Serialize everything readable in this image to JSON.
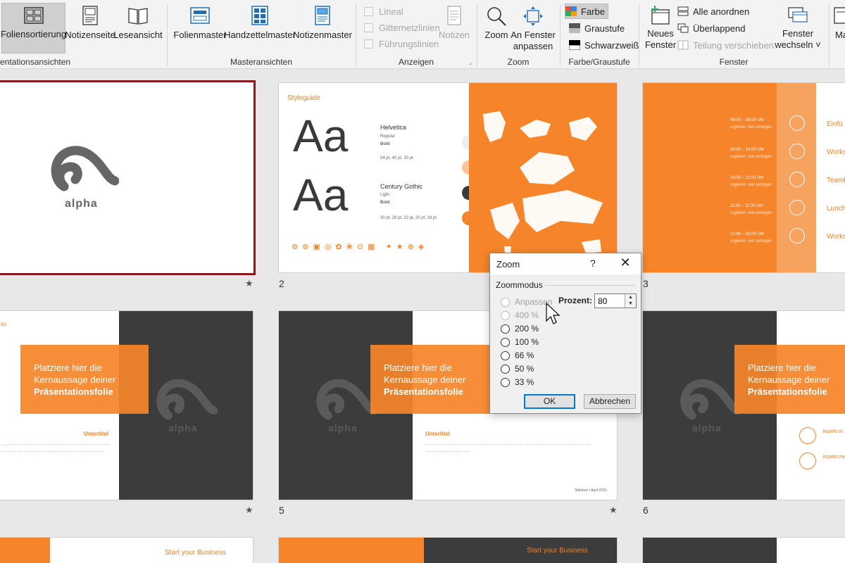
{
  "ribbon": {
    "groups": {
      "presentation_views": "entationsansichten",
      "master_views": "Masteransichten",
      "show": "Anzeigen",
      "zoom": "Zoom",
      "color": "Farbe/Graustufe",
      "window": "Fenster"
    },
    "buttons": {
      "slide_sorter": "Foliensortierung",
      "notes_page": "Notizenseite",
      "reading_view": "Leseansicht",
      "slide_master": "Folienmaster",
      "handout_master": "Handzettelmaster",
      "notes_master": "Notizenmaster",
      "ruler": "Lineal",
      "gridlines": "Gitternetzlinien",
      "guides": "Führungslinien",
      "notes": "Notizen",
      "zoom": "Zoom",
      "fit_window_1": "An Fenster",
      "fit_window_2": "anpassen",
      "color": "Farbe",
      "grayscale": "Graustufe",
      "black_white": "Schwarzweiß",
      "new_window_1": "Neues",
      "new_window_2": "Fenster",
      "arrange_all": "Alle anordnen",
      "cascade": "Überlappend",
      "move_split": "Teilung verschieben",
      "switch_window_1": "Fenster",
      "switch_window_2": "wechseln ˅",
      "macros": "Ma"
    }
  },
  "slides": {
    "s1": {
      "logo_word": "alpha"
    },
    "s2": {
      "num": "2",
      "title": "Styleguide",
      "aa": "Aa",
      "font1": "Helvetica",
      "font1_w1": "Regular",
      "font1_w2": "Bold",
      "font1_sizes": "54 pt, 40 pt, 30 pt",
      "font2": "Century Gothic",
      "font2_w1": "Light",
      "font2_w2": "Bold",
      "font2_sizes": "30 pt, 28 pt, 22 pt, 20 pt, 18 pt"
    },
    "s3": {
      "num": "3",
      "times": [
        "08:00 – 09:00 Uhr",
        "09:00 – 10:00 Uhr",
        "10:00 – 11:00 Uhr",
        "11:00 – 11:30 Uhr",
        "12:30 – 03:00 Uhr"
      ],
      "labels": [
        "Einfü",
        "Works",
        "Teaml",
        "Lunch",
        "Works"
      ],
      "caption": "Eigenen Text einfügen"
    },
    "callout": {
      "line1": "Platziere hier die",
      "line2": "Kernaussage deiner",
      "line3": "Präsentationsfolie"
    },
    "s4": {
      "logo_word": "alpha",
      "subtitle": "Untertitel"
    },
    "s5": {
      "num": "5",
      "logo_word": "alpha",
      "subtitle": "Untertitel",
      "footer": "Slidebox | April 2020"
    },
    "s6": {
      "num": "6",
      "logo_word": "alpha",
      "aspect1": "Aspekt ei",
      "aspect2": "Aspekt zw"
    },
    "row3": {
      "banner1": "Start your Business",
      "banner2": "Start your Business"
    }
  },
  "dialog": {
    "title": "Zoom",
    "help": "?",
    "close": "✕",
    "group": "Zoommodus",
    "percent_label": "Prozent:",
    "percent_value": "80",
    "options": {
      "fit": "Anpassen",
      "p400": "400 %",
      "p200": "200 %",
      "p100": "100 %",
      "p66": "66 %",
      "p50": "50 %",
      "p33": "33 %"
    },
    "ok": "OK",
    "cancel": "Abbrechen"
  },
  "colors": {
    "accent": "#f5842a",
    "dark": "#3c3c3c",
    "selection": "#8b1a1a"
  }
}
